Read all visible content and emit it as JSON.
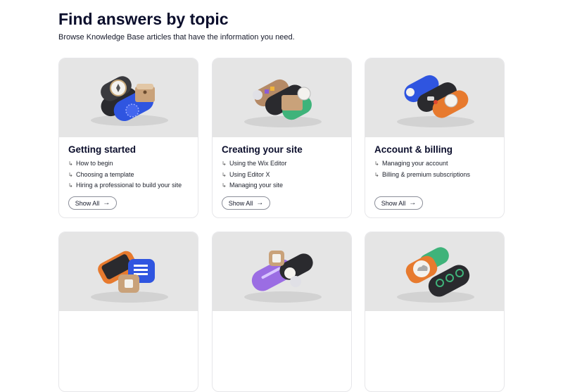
{
  "header": {
    "title": "Find answers by topic",
    "subtitle": "Browse Knowledge Base articles that have the information you need."
  },
  "cards": [
    {
      "title": "Getting started",
      "links": [
        "How to begin",
        "Choosing a template",
        "Hiring a professional to build your site"
      ],
      "button": "Show All"
    },
    {
      "title": "Creating your site",
      "links": [
        "Using the Wix Editor",
        "Using Editor X",
        "Managing your site"
      ],
      "button": "Show All"
    },
    {
      "title": "Account & billing",
      "links": [
        "Managing your account",
        "Billing & premium subscriptions"
      ],
      "button": "Show All"
    },
    {
      "title": "",
      "links": [],
      "button": ""
    },
    {
      "title": "",
      "links": [],
      "button": ""
    },
    {
      "title": "",
      "links": [],
      "button": ""
    }
  ],
  "icons": {
    "link_arrow": "↳",
    "button_arrow": "→"
  },
  "colors": {
    "hero_background": "#e5e5e5",
    "card_border": "#e6e6e9",
    "heading": "#0b0e2c"
  }
}
